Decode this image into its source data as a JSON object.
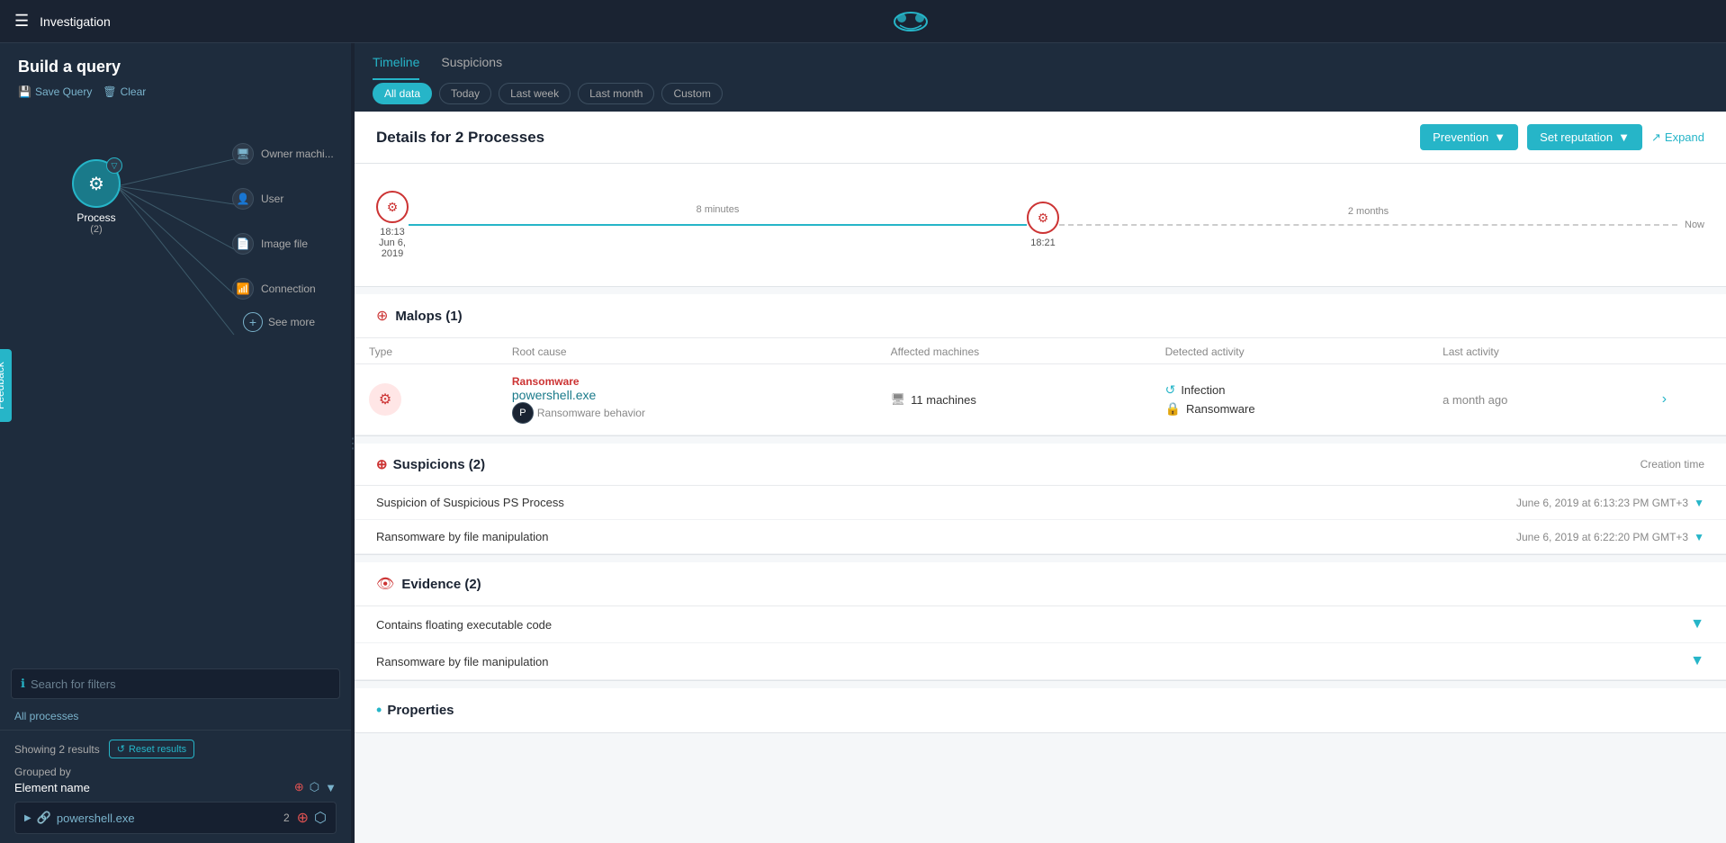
{
  "app": {
    "nav_icon": "☰",
    "nav_title": "Investigation"
  },
  "left_panel": {
    "query_title": "Build a query",
    "save_query_label": "Save Query",
    "clear_label": "Clear",
    "graph": {
      "process_node_label": "Process",
      "process_node_count": "(2)",
      "connected_nodes": [
        {
          "label": "Owner machi...",
          "icon": "🖥"
        },
        {
          "label": "User",
          "icon": "👤"
        },
        {
          "label": "Image file",
          "icon": "📄"
        },
        {
          "label": "Connection",
          "icon": "📶"
        }
      ],
      "see_more_label": "See more"
    },
    "search_placeholder": "Search for filters",
    "all_processes_label": "All processes",
    "results": {
      "showing_label": "Showing 2 results",
      "reset_label": "Reset results",
      "grouped_by_label": "Grouped by",
      "element_name_label": "Element name",
      "rows": [
        {
          "name": "powershell.exe",
          "count": "2"
        }
      ]
    }
  },
  "right_panel": {
    "tabs": [
      {
        "label": "Timeline",
        "active": true
      },
      {
        "label": "Suspicions",
        "active": false
      }
    ],
    "date_filters": [
      {
        "label": "All data",
        "active": true
      },
      {
        "label": "Today",
        "active": false
      },
      {
        "label": "Last week",
        "active": false
      },
      {
        "label": "Last month",
        "active": false
      },
      {
        "label": "Custom",
        "active": false
      }
    ],
    "detail": {
      "title": "Details for 2 Processes",
      "prevention_label": "Prevention",
      "set_reputation_label": "Set reputation",
      "expand_label": "Expand",
      "timeline": {
        "start_time": "18:13",
        "start_date": "Jun 6,",
        "start_year": "2019",
        "mid_time": "18:21",
        "gap_label_1": "8 minutes",
        "gap_label_2": "2 months",
        "end_label": "Now"
      },
      "malops": {
        "section_title": "Malops (1)",
        "columns": [
          "Type",
          "Root cause",
          "Affected machines",
          "Detected activity",
          "Last activity"
        ],
        "rows": [
          {
            "type": "Ransomware",
            "name": "powershell.exe",
            "behavior": "Ransomware behavior",
            "machines": "11 machines",
            "activity_1": "Infection",
            "activity_2": "Ransomware",
            "last_activity": "a month ago"
          }
        ]
      },
      "suspicions": {
        "section_title": "Suspicions (2)",
        "creation_time_label": "Creation time",
        "rows": [
          {
            "name": "Suspicion of Suspicious PS Process",
            "time": "June 6, 2019 at 6:13:23 PM GMT+3"
          },
          {
            "name": "Ransomware by file manipulation",
            "time": "June 6, 2019 at 6:22:20 PM GMT+3"
          }
        ]
      },
      "evidence": {
        "section_title": "Evidence (2)",
        "rows": [
          {
            "name": "Contains floating executable code"
          },
          {
            "name": "Ransomware by file manipulation"
          }
        ]
      },
      "properties": {
        "title": "Properties"
      }
    }
  },
  "feedback_label": "Feedback"
}
